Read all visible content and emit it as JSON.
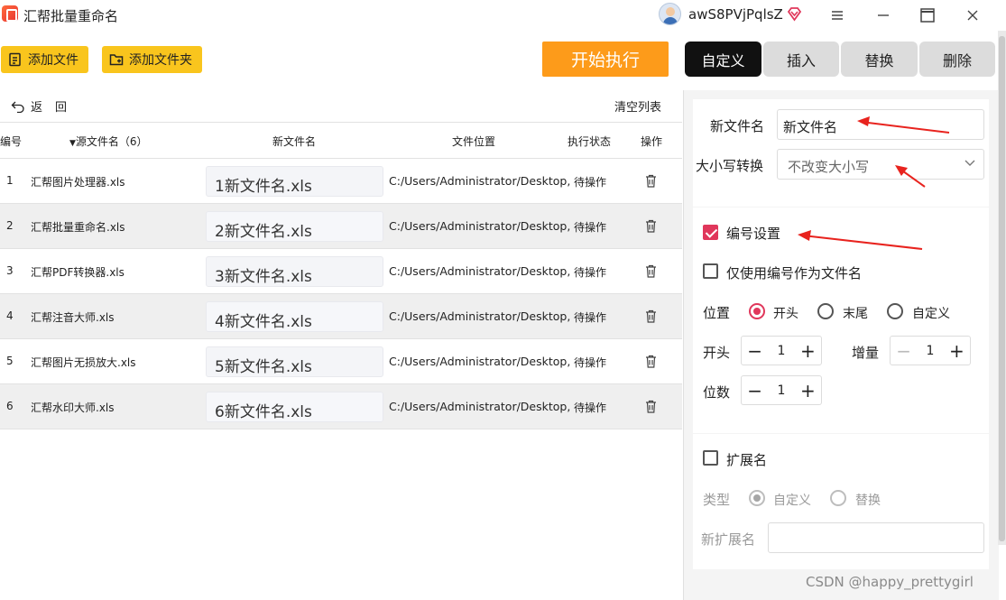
{
  "app": {
    "title": "汇帮批量重命名"
  },
  "user": {
    "name": "awS8PVjPqlsZ"
  },
  "toolbar": {
    "add_file": "添加文件",
    "add_folder": "添加文件夹",
    "start": "开始执行"
  },
  "tabs": [
    {
      "label": "自定义",
      "active": true
    },
    {
      "label": "插入",
      "active": false
    },
    {
      "label": "替换",
      "active": false
    },
    {
      "label": "删除",
      "active": false
    }
  ],
  "list": {
    "back": "返",
    "back2": "回",
    "clear": "清空列表",
    "headers": {
      "index": "编号",
      "source": "源文件名（6）",
      "newname": "新文件名",
      "location": "文件位置",
      "status": "执行状态",
      "action": "操作"
    },
    "rows": [
      {
        "index": "1",
        "source": "汇帮图片处理器.xls",
        "newname": "1新文件名.xls",
        "location": "C:/Users/Administrator/Desktop,",
        "status": "待操作"
      },
      {
        "index": "2",
        "source": "汇帮批量重命名.xls",
        "newname": "2新文件名.xls",
        "location": "C:/Users/Administrator/Desktop,",
        "status": "待操作"
      },
      {
        "index": "3",
        "source": "汇帮PDF转换器.xls",
        "newname": "3新文件名.xls",
        "location": "C:/Users/Administrator/Desktop,",
        "status": "待操作"
      },
      {
        "index": "4",
        "source": "汇帮注音大师.xls",
        "newname": "4新文件名.xls",
        "location": "C:/Users/Administrator/Desktop,",
        "status": "待操作"
      },
      {
        "index": "5",
        "source": "汇帮图片无损放大.xls",
        "newname": "5新文件名.xls",
        "location": "C:/Users/Administrator/Desktop,",
        "status": "待操作"
      },
      {
        "index": "6",
        "source": "汇帮水印大师.xls",
        "newname": "6新文件名.xls",
        "location": "C:/Users/Administrator/Desktop,",
        "status": "待操作"
      }
    ]
  },
  "panel": {
    "newname_label": "新文件名",
    "newname_value": "新文件名",
    "case_label": "大小写转换",
    "case_value": "不改变大小写",
    "numbering_label": "编号设置",
    "numbering_checked": true,
    "only_number_label": "仅使用编号作为文件名",
    "only_number_checked": false,
    "position_label": "位置",
    "position_options": [
      "开头",
      "末尾",
      "自定义"
    ],
    "position_selected": "开头",
    "start_label": "开头",
    "start_value": "1",
    "increment_label": "增量",
    "increment_value": "1",
    "digits_label": "位数",
    "digits_value": "1",
    "ext_label": "扩展名",
    "ext_checked": false,
    "type_label": "类型",
    "type_options": [
      "自定义",
      "替换"
    ],
    "type_selected": "自定义",
    "new_ext_label": "新扩展名",
    "new_ext_value": ""
  },
  "colors": {
    "accent": "#e0375b",
    "toolbar": "#f9c51d",
    "start": "#fd9b1a",
    "arrow": "#e8231e"
  },
  "watermark": "CSDN @happy_prettygirl"
}
